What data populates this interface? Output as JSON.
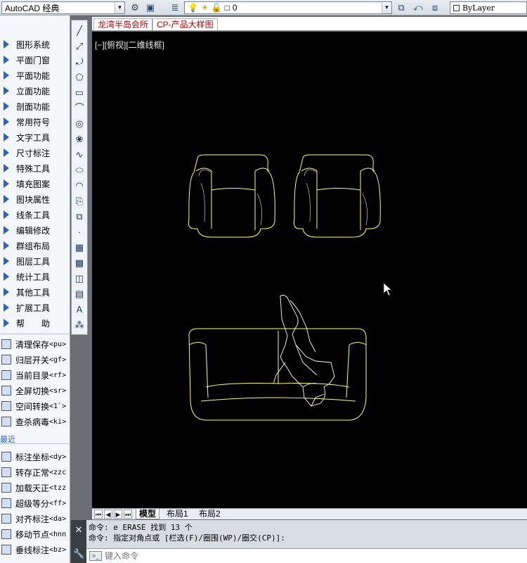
{
  "toolbar": {
    "workspace": "AutoCAD 经典",
    "layer": "0",
    "linetype": "ByLayer"
  },
  "doc_tabs": [
    "龙湾半岛会所",
    "CP-产品大样图"
  ],
  "view_label": "[−][俯视][二维线框]",
  "left_menu": {
    "tools": [
      "图形系统",
      "平面门窗",
      "平面功能",
      "立面功能",
      "剖面功能",
      "常用符号",
      "文字工具",
      "尺寸标注",
      "特殊工具",
      "填充图案",
      "图块属性",
      "线条工具",
      "编辑修改",
      "群组布局",
      "图层工具",
      "统计工具",
      "其他工具",
      "扩展工具",
      "帮　　助"
    ],
    "commands": [
      {
        "label": "清理保存",
        "short": "<pu>"
      },
      {
        "label": "归层开关",
        "short": "<gf>"
      },
      {
        "label": "当前目录",
        "short": "<rf>"
      },
      {
        "label": "全屏切换",
        "short": "<sr>"
      },
      {
        "label": "空间转换",
        "short": "<1`>"
      },
      {
        "label": "查杀病毒",
        "short": "<ki>"
      }
    ],
    "recent_label": "最近",
    "recent": [
      {
        "label": "标注坐标",
        "short": "<dy>"
      },
      {
        "label": "转存正常",
        "short": "<zzc"
      },
      {
        "label": "加载天正",
        "short": "<tzz"
      },
      {
        "label": "超级等分",
        "short": "<ff>"
      },
      {
        "label": "对齐标注",
        "short": "<da>"
      },
      {
        "label": "移动节点",
        "short": "<hnn"
      },
      {
        "label": "垂线标注",
        "short": "<bz>"
      }
    ]
  },
  "layout_tabs": [
    "模型",
    "布局1",
    "布局2"
  ],
  "command": {
    "history": [
      "命令: e ERASE 找到 13 个",
      "命令: 指定对角点或 [栏选(F)/圈围(WP)/圈交(CP)]:"
    ],
    "placeholder": "键入命令"
  },
  "colors": {
    "canvas": "#000000",
    "furniture": "#ffff66",
    "person": "#ffffff",
    "tab_text": "#c00000"
  }
}
